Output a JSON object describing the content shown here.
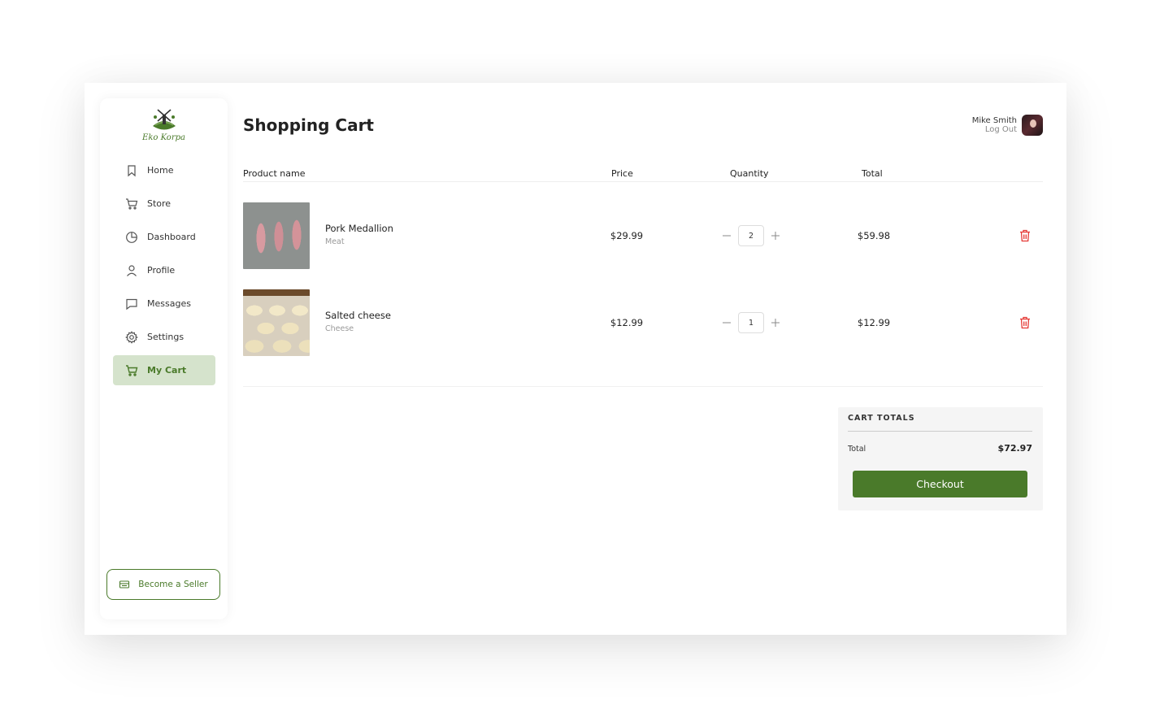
{
  "brand": {
    "name": "Eko Korpa",
    "color": "#4a7a2a",
    "logo_icon": "windmill-hill-logo"
  },
  "sidebar": {
    "items": [
      {
        "label": "Home",
        "icon": "bookmark-icon",
        "active": false
      },
      {
        "label": "Store",
        "icon": "cart-icon",
        "active": false
      },
      {
        "label": "Dashboard",
        "icon": "pie-chart-icon",
        "active": false
      },
      {
        "label": "Profile",
        "icon": "user-icon",
        "active": false
      },
      {
        "label": "Messages",
        "icon": "chat-icon",
        "active": false
      },
      {
        "label": "Settings",
        "icon": "gear-icon",
        "active": false
      },
      {
        "label": "My Cart",
        "icon": "cart-icon",
        "active": true
      }
    ],
    "become_seller": "Become a Seller"
  },
  "page": {
    "title": "Shopping Cart"
  },
  "user": {
    "name": "Mike Smith",
    "logout": "Log Out"
  },
  "table": {
    "headers": {
      "product": "Product name",
      "price": "Price",
      "quantity": "Quantity",
      "total": "Total"
    },
    "rows": [
      {
        "name": "Pork Medallion",
        "category": "Meat",
        "price": "$29.99",
        "quantity": "2",
        "total": "$59.98"
      },
      {
        "name": "Salted cheese",
        "category": "Cheese",
        "price": "$12.99",
        "quantity": "1",
        "total": "$12.99"
      }
    ]
  },
  "cart_totals": {
    "title": "CART TOTALS",
    "total_label": "Total",
    "total_value": "$72.97",
    "checkout_label": "Checkout"
  },
  "colors": {
    "accent": "#4a7a2a",
    "active_bg": "#d5e3cc",
    "danger": "#e53935"
  }
}
